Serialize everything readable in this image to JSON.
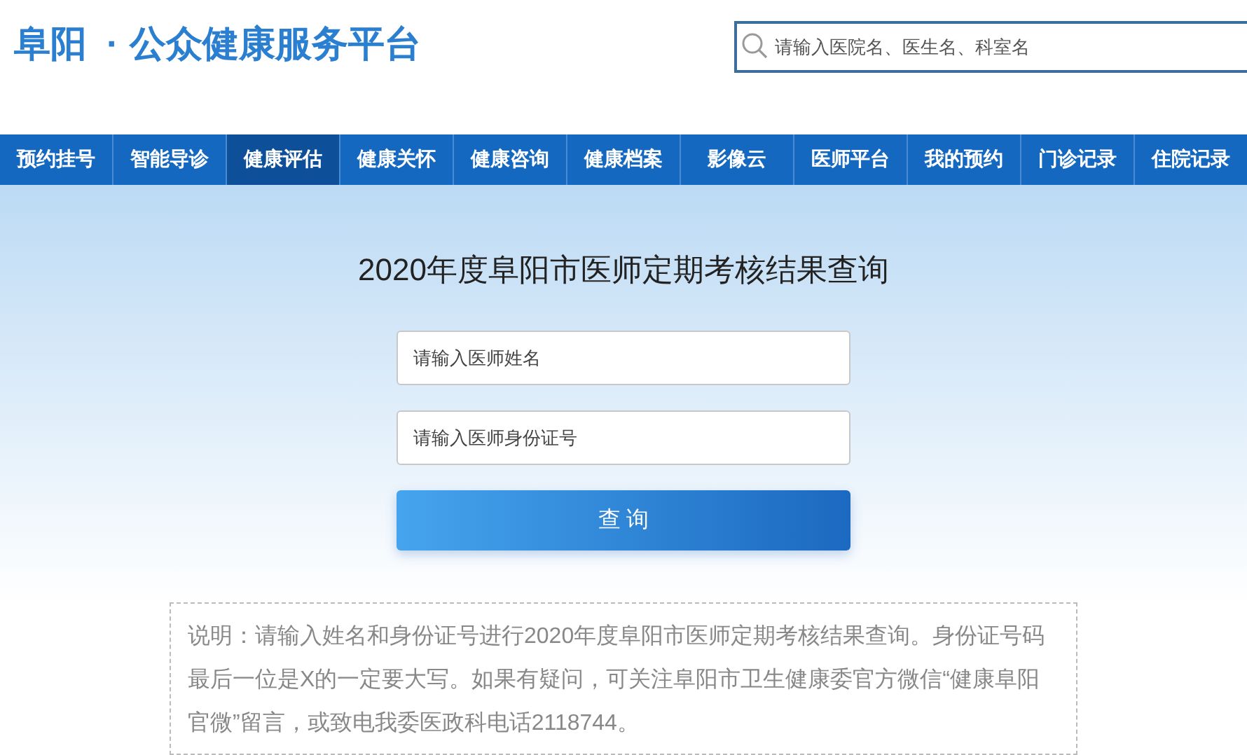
{
  "header": {
    "logo_city": "阜阳",
    "logo_dot": "·",
    "logo_title": "公众健康服务平台",
    "search": {
      "placeholder": "请输入医院名、医生名、科室名"
    }
  },
  "nav": [
    {
      "label": "预约挂号",
      "selected": false
    },
    {
      "label": "智能导诊",
      "selected": false
    },
    {
      "label": "健康评估",
      "selected": true
    },
    {
      "label": "健康关怀",
      "selected": false
    },
    {
      "label": "健康咨询",
      "selected": false
    },
    {
      "label": "健康档案",
      "selected": false
    },
    {
      "label": "影像云",
      "selected": false
    },
    {
      "label": "医师平台",
      "selected": false
    },
    {
      "label": "我的预约",
      "selected": false
    },
    {
      "label": "门诊记录",
      "selected": false
    },
    {
      "label": "住院记录",
      "selected": false
    }
  ],
  "form": {
    "title": "2020年度阜阳市医师定期考核结果查询",
    "name_field": {
      "placeholder": "请输入医师姓名"
    },
    "id_field": {
      "placeholder": "请输入医师身份证号"
    },
    "submit": "查 询"
  },
  "note": "说明：请输入姓名和身份证号进行2020年度阜阳市医师定期考核结果查询。身份证号码最后一位是X的一定要大写。如果有疑问，可关注阜阳市卫生健康委官方微信“健康阜阳官微”留言，或致电我委医政科电话2118744。"
}
